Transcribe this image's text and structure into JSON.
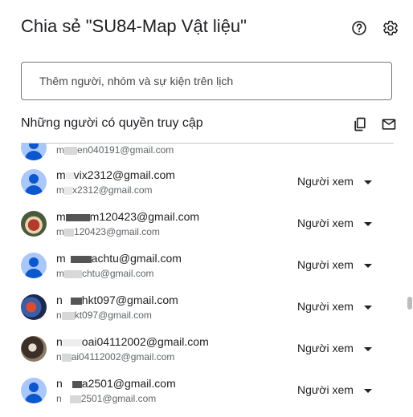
{
  "dialog": {
    "title": "Chia sẻ \"SU84-Map Vật liệu\"",
    "help_icon": "help-circle-icon",
    "settings_icon": "gear-icon"
  },
  "search": {
    "placeholder": "Thêm người, nhóm và sự kiện trên lịch"
  },
  "section": {
    "title": "Những người có quyền truy cập",
    "copy_icon": "copy-icon",
    "email_icon": "mail-icon"
  },
  "people": [
    {
      "email_a": "m",
      "email_b": "",
      "sub_a": "m",
      "sub_b": "en040191@gmail.com",
      "role": "",
      "avatar": "default"
    },
    {
      "email_a": "m",
      "email_b": "vix2312@gmail.com",
      "sub_a": "m",
      "sub_b": "x2312@gmail.com",
      "role": "Người xem",
      "avatar": "default"
    },
    {
      "email_a": "m",
      "email_b": "m120423@gmail.com",
      "sub_a": "m",
      "sub_b": "120423@gmail.com",
      "role": "Người xem",
      "avatar": "photo1"
    },
    {
      "email_a": "m",
      "email_b": "achtu@gmail.com",
      "sub_a": "m",
      "sub_b": "chtu@gmail.com",
      "role": "Người xem",
      "avatar": "default"
    },
    {
      "email_a": "n",
      "email_b": "hkt097@gmail.com",
      "sub_a": "n",
      "sub_b": "kt097@gmail.com",
      "role": "Người xem",
      "avatar": "photo2"
    },
    {
      "email_a": "n",
      "email_b": "oai04112002@gmail.com",
      "sub_a": "n",
      "sub_b": "ai04112002@gmail.com",
      "role": "Người xem",
      "avatar": "photo3"
    },
    {
      "email_a": "n",
      "email_b": "a2501@gmail.com",
      "sub_a": "n",
      "sub_b": "2501@gmail.com",
      "role": "Người xem",
      "avatar": "default"
    }
  ]
}
